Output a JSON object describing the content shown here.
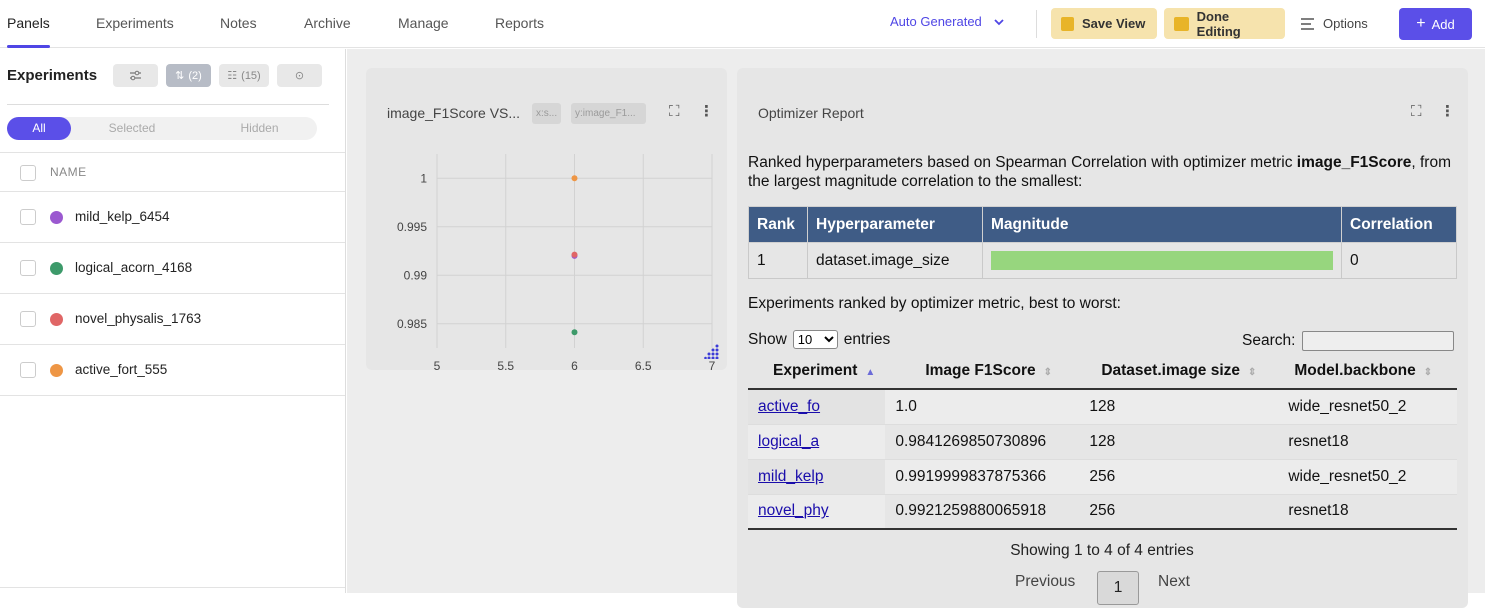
{
  "nav": {
    "tabs": [
      "Panels",
      "Experiments",
      "Notes",
      "Archive",
      "Manage",
      "Reports"
    ],
    "active_tab": "Panels",
    "dashboard_select": "Auto Generated",
    "save_view": "Save View",
    "done_editing": "Done Editing",
    "options": "Options",
    "add": "Add"
  },
  "sidebar": {
    "title": "Experiments",
    "chip_count_sort": "(2)",
    "chip_count_columns": "(15)",
    "filter_tabs": [
      "All",
      "Selected",
      "Hidden"
    ],
    "column_header": "NAME",
    "experiments": [
      {
        "name": "mild_kelp_6454",
        "color": "#9b59d0"
      },
      {
        "name": "logical_acorn_4168",
        "color": "#3d9a6a"
      },
      {
        "name": "novel_physalis_1763",
        "color": "#e06666"
      },
      {
        "name": "active_fort_555",
        "color": "#ee9645"
      }
    ]
  },
  "chart_panel": {
    "title": "image_F1Score VS...",
    "tag_x": "x:s...",
    "tag_y": "y:image_F1..."
  },
  "chart_data": {
    "type": "scatter",
    "title": "image_F1Score VS...",
    "xlabel": "",
    "ylabel": "",
    "xlim": [
      5,
      7
    ],
    "ylim": [
      0.9825,
      1.0025
    ],
    "xticks": [
      "5",
      "5.5",
      "6",
      "6.5",
      "7"
    ],
    "yticks": [
      "1",
      "0.995",
      "0.99",
      "0.985"
    ],
    "grid": true,
    "points": [
      {
        "x": 6,
        "y": 1.0,
        "color": "#ee9645"
      },
      {
        "x": 6,
        "y": 0.9919999837875366,
        "color": "#9b59d0"
      },
      {
        "x": 6,
        "y": 0.9921259880065918,
        "color": "#e06666"
      },
      {
        "x": 6,
        "y": 0.9841269850730896,
        "color": "#3d9a6a"
      }
    ]
  },
  "report": {
    "title": "Optimizer Report",
    "intro_prefix": "Ranked hyperparameters based on Spearman Correlation with optimizer metric ",
    "intro_metric": "image_F1Score",
    "intro_suffix": ", from the largest magnitude correlation to the smallest:",
    "rank_headers": [
      "Rank",
      "Hyperparameter",
      "Magnitude",
      "Correlation"
    ],
    "rank_rows": [
      {
        "rank": "1",
        "hyperparameter": "dataset.image_size",
        "magnitude": 1.0,
        "correlation": "0"
      }
    ],
    "ranked_label": "Experiments ranked by optimizer metric, best to worst:",
    "show_prefix": "Show",
    "show_value": "10",
    "show_suffix": "entries",
    "search_label": "Search:",
    "exp_headers": [
      "Experiment",
      "Image F1Score",
      "Dataset.image size",
      "Model.backbone"
    ],
    "exp_rows": [
      {
        "experiment": "active_fo",
        "f1": "1.0",
        "image_size": "128",
        "backbone": "wide_resnet50_2"
      },
      {
        "experiment": "logical_a",
        "f1": "0.9841269850730896",
        "image_size": "128",
        "backbone": "resnet18"
      },
      {
        "experiment": "mild_kelp",
        "f1": "0.9919999837875366",
        "image_size": "256",
        "backbone": "wide_resnet50_2"
      },
      {
        "experiment": "novel_phy",
        "f1": "0.9921259880065918",
        "image_size": "256",
        "backbone": "resnet18"
      }
    ],
    "info": "Showing 1 to 4 of 4 entries",
    "previous": "Previous",
    "page": "1",
    "next": "Next"
  }
}
